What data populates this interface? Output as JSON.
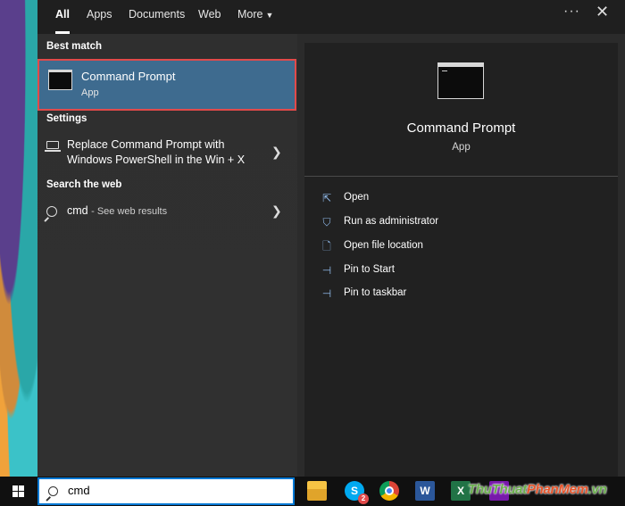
{
  "tabs": [
    {
      "label": "All"
    },
    {
      "label": "Apps"
    },
    {
      "label": "Documents"
    },
    {
      "label": "Web"
    },
    {
      "label": "More"
    }
  ],
  "best_match": {
    "section_label": "Best match",
    "title": "Command Prompt",
    "subtitle": "App"
  },
  "settings": {
    "section_label": "Settings",
    "item_line1": "Replace Command Prompt with",
    "item_line2": "Windows PowerShell in the Win + X"
  },
  "search_web": {
    "section_label": "Search the web",
    "query": "cmd",
    "suffix": "- See web results"
  },
  "preview": {
    "title": "Command Prompt",
    "subtitle": "App",
    "actions": [
      {
        "label": "Open",
        "icon": "open-icon"
      },
      {
        "label": "Run as administrator",
        "icon": "shield-icon"
      },
      {
        "label": "Open file location",
        "icon": "file-location-icon"
      },
      {
        "label": "Pin to Start",
        "icon": "pin-icon"
      },
      {
        "label": "Pin to taskbar",
        "icon": "pin-icon"
      }
    ]
  },
  "taskbar": {
    "search_value": "cmd",
    "skype_badge": "2",
    "word_letter": "W",
    "excel_letter": "X",
    "skype_letter": "S"
  },
  "watermark": {
    "part1": "ThuThuat",
    "part2": "PhanMem",
    "part3": ".vn"
  },
  "colors": {
    "selection": "#3e6b8f",
    "highlight_border": "#e24a4a",
    "accent": "#0078d4"
  }
}
